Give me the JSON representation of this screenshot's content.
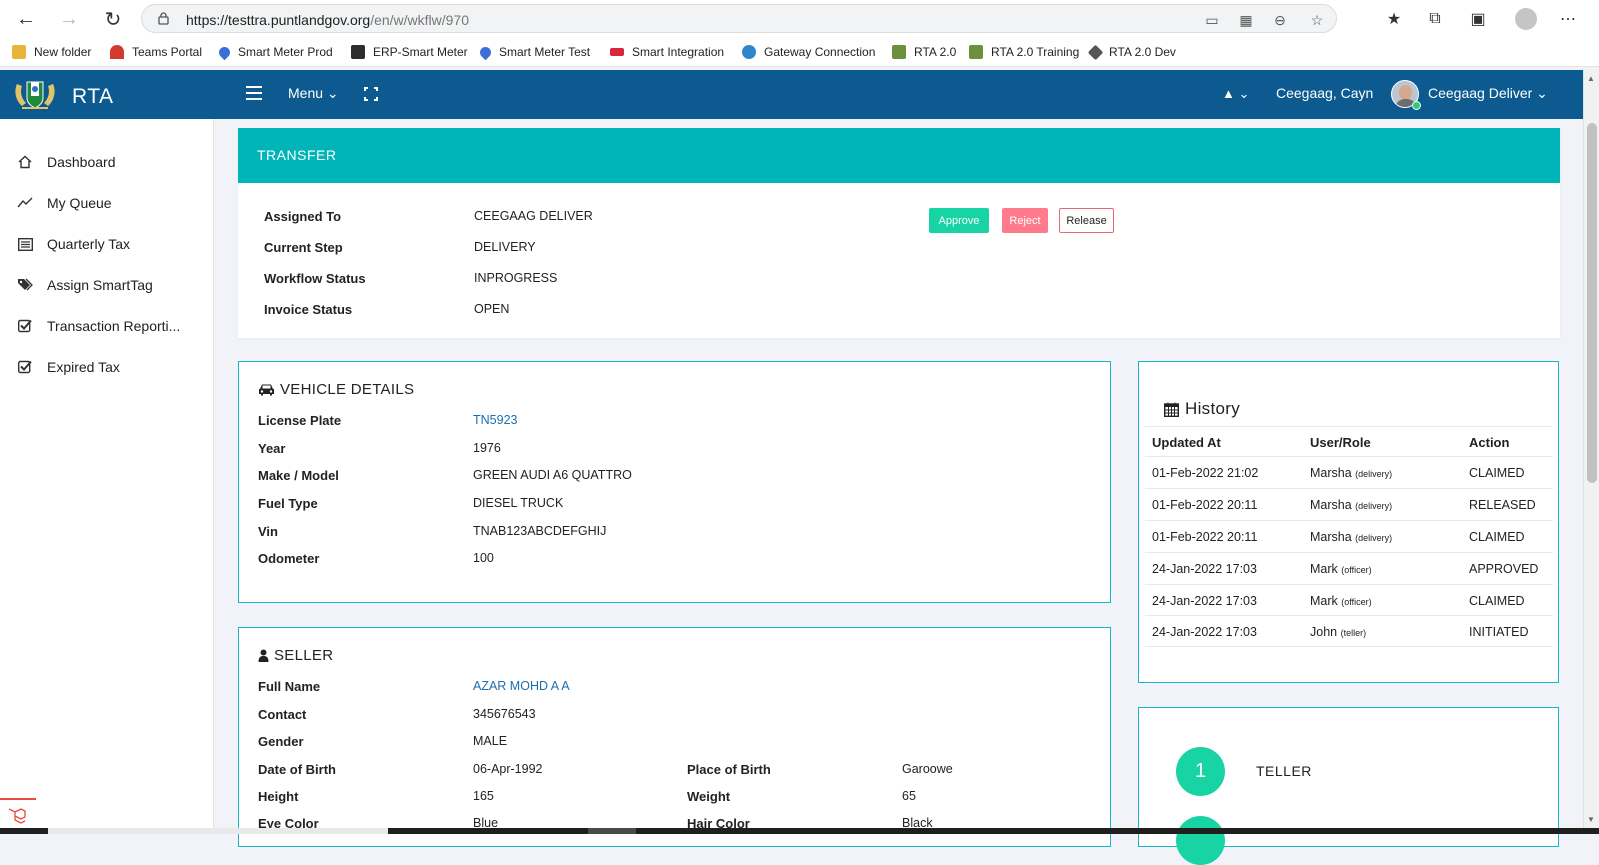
{
  "browser": {
    "url_host": "https://testtra.puntlandgov.org",
    "url_path": "/en/w/wkflw/970",
    "bookmarks": [
      {
        "label": "New folder",
        "color": "#e8b53b"
      },
      {
        "label": "Teams Portal",
        "color": "#d23a2f"
      },
      {
        "label": "Smart Meter Prod",
        "color": "#3a6fd8"
      },
      {
        "label": "ERP-Smart Meter",
        "color": "#2d2d2d"
      },
      {
        "label": "Smart Meter Test",
        "color": "#3a6fd8"
      },
      {
        "label": "Smart Integration",
        "color": "#d8283c"
      },
      {
        "label": "Gateway Connection",
        "color": "#2f86c9"
      },
      {
        "label": "RTA 2.0",
        "color": "#6b8f3a"
      },
      {
        "label": "RTA 2.0 Training",
        "color": "#6b8f3a"
      },
      {
        "label": "RTA 2.0 Dev",
        "color": "#555555"
      }
    ]
  },
  "header": {
    "app_name": "RTA",
    "menu_label": "Menu ⌄",
    "user_icon": "▲ ⌄",
    "user_name": "Ceegaag, Cayn",
    "role_label": "Ceegaag Deliver ⌄",
    "bg_color": "#0c5a8f"
  },
  "sidebar": {
    "items": [
      {
        "label": "Dashboard",
        "icon": "home-icon"
      },
      {
        "label": "My Queue",
        "icon": "trend-icon"
      },
      {
        "label": "Quarterly Tax",
        "icon": "list-icon"
      },
      {
        "label": "Assign SmartTag",
        "icon": "tags-icon"
      },
      {
        "label": "Transaction Reporti...",
        "icon": "check-square-icon"
      },
      {
        "label": "Expired Tax",
        "icon": "check-square-icon"
      }
    ]
  },
  "transfer": {
    "title": "TRANSFER",
    "accent": "#00b5b8",
    "fields": [
      {
        "label": "Assigned To",
        "value": "CEEGAAG DELIVER"
      },
      {
        "label": "Current Step",
        "value": "DELIVERY"
      },
      {
        "label": "Workflow Status",
        "value": "INPROGRESS"
      },
      {
        "label": "Invoice Status",
        "value": "OPEN"
      }
    ],
    "actions": {
      "approve": "Approve",
      "reject": "Reject",
      "release": "Release"
    }
  },
  "vehicle": {
    "title": "VEHICLE DETAILS",
    "fields": [
      {
        "label": "License Plate",
        "value": "TN5923"
      },
      {
        "label": "Year",
        "value": "1976"
      },
      {
        "label": "Make / Model",
        "value": "GREEN AUDI A6 QUATTRO"
      },
      {
        "label": "Fuel Type",
        "value": "DIESEL TRUCK"
      },
      {
        "label": "Vin",
        "value": "TNAB123ABCDEFGHIJ"
      },
      {
        "label": "Odometer",
        "value": "100"
      }
    ]
  },
  "seller": {
    "title": "SELLER",
    "left_fields": [
      {
        "label": "Full Name",
        "value": "AZAR MOHD A A"
      },
      {
        "label": "Contact",
        "value": "345676543"
      },
      {
        "label": "Gender",
        "value": "MALE"
      },
      {
        "label": "Date of Birth",
        "value": "06-Apr-1992"
      },
      {
        "label": "Height",
        "value": "165"
      },
      {
        "label": "Eye Color",
        "value": "Blue"
      }
    ],
    "right_fields": [
      {
        "label": "Place of Birth",
        "value": "Garoowe"
      },
      {
        "label": "Weight",
        "value": "65"
      },
      {
        "label": "Hair Color",
        "value": "Black"
      }
    ]
  },
  "history": {
    "title": "History",
    "columns": [
      "Updated At",
      "User/Role",
      "Action"
    ],
    "rows": [
      {
        "updated": "01-Feb-2022 21:02",
        "user": "Marsha",
        "role": "(delivery)",
        "action": "CLAIMED"
      },
      {
        "updated": "01-Feb-2022 20:11",
        "user": "Marsha",
        "role": "(delivery)",
        "action": "RELEASED"
      },
      {
        "updated": "01-Feb-2022 20:11",
        "user": "Marsha",
        "role": "(delivery)",
        "action": "CLAIMED"
      },
      {
        "updated": "24-Jan-2022 17:03",
        "user": "Mark",
        "role": "(officer)",
        "action": "APPROVED"
      },
      {
        "updated": "24-Jan-2022 17:03",
        "user": "Mark",
        "role": "(officer)",
        "action": "CLAIMED"
      },
      {
        "updated": "24-Jan-2022 17:03",
        "user": "John",
        "role": "(teller)",
        "action": "INITIATED"
      }
    ]
  },
  "steps": [
    {
      "number": "1",
      "label": "TELLER"
    }
  ]
}
